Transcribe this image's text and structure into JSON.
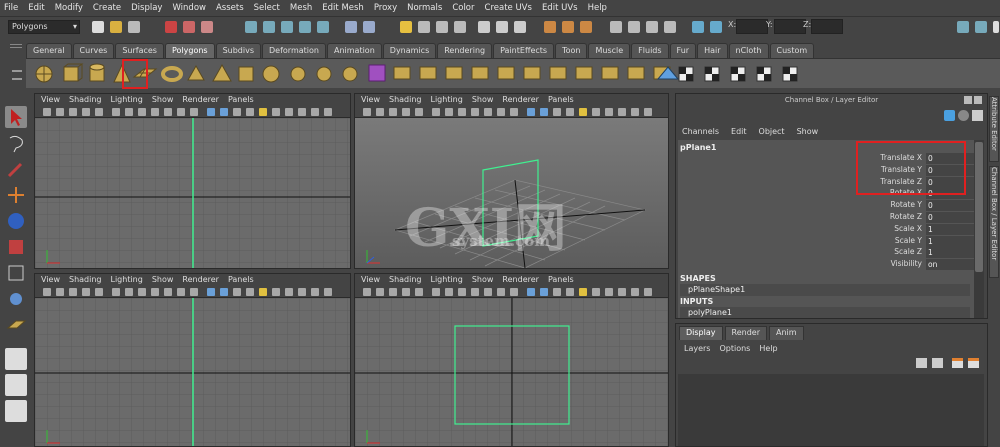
{
  "menubar": [
    "File",
    "Edit",
    "Modify",
    "Create",
    "Display",
    "Window",
    "Assets",
    "Select",
    "Mesh",
    "Edit Mesh",
    "Proxy",
    "Normals",
    "Color",
    "Create UVs",
    "Edit UVs",
    "Help"
  ],
  "status": {
    "mode": "Polygons",
    "x_label": "X:",
    "y_label": "Y:",
    "z_label": "Z:"
  },
  "shelf_tabs": [
    {
      "label": "General",
      "active": false
    },
    {
      "label": "Curves",
      "active": false
    },
    {
      "label": "Surfaces",
      "active": false
    },
    {
      "label": "Polygons",
      "active": true
    },
    {
      "label": "Subdivs",
      "active": false
    },
    {
      "label": "Deformation",
      "active": false
    },
    {
      "label": "Animation",
      "active": false
    },
    {
      "label": "Dynamics",
      "active": false
    },
    {
      "label": "Rendering",
      "active": false
    },
    {
      "label": "PaintEffects",
      "active": false
    },
    {
      "label": "Toon",
      "active": false
    },
    {
      "label": "Muscle",
      "active": false
    },
    {
      "label": "Fluids",
      "active": false
    },
    {
      "label": "Fur",
      "active": false
    },
    {
      "label": "Hair",
      "active": false
    },
    {
      "label": "nCloth",
      "active": false
    },
    {
      "label": "Custom",
      "active": false
    }
  ],
  "viewport_menu": [
    "View",
    "Shading",
    "Lighting",
    "Show",
    "Renderer",
    "Panels"
  ],
  "channel_box": {
    "title": "Channel Box / Layer Editor",
    "menu": [
      "Channels",
      "Edit",
      "Object",
      "Show"
    ],
    "object_name": "pPlane1",
    "attributes": [
      {
        "name": "Translate X",
        "value": "0"
      },
      {
        "name": "Translate Y",
        "value": "0"
      },
      {
        "name": "Translate Z",
        "value": "0"
      },
      {
        "name": "Rotate X",
        "value": "0"
      },
      {
        "name": "Rotate Y",
        "value": "0"
      },
      {
        "name": "Rotate Z",
        "value": "0"
      },
      {
        "name": "Scale X",
        "value": "1"
      },
      {
        "name": "Scale Y",
        "value": "1"
      },
      {
        "name": "Scale Z",
        "value": "1"
      },
      {
        "name": "Visibility",
        "value": "on"
      }
    ],
    "shapes_label": "SHAPES",
    "shape_name": "pPlaneShape1",
    "inputs_label": "INPUTS",
    "input_name": "polyPlane1"
  },
  "side_tabs": {
    "attribute_editor": "Attribute Editor",
    "channel_box": "Channel Box / Layer Editor"
  },
  "layer_editor": {
    "tabs": [
      {
        "label": "Display",
        "active": true
      },
      {
        "label": "Render",
        "active": false
      },
      {
        "label": "Anim",
        "active": false
      }
    ],
    "menu": [
      "Layers",
      "Options",
      "Help"
    ]
  },
  "watermark": {
    "main": "GXI网",
    "sub": "system.com"
  },
  "colors": {
    "highlight": "#e02020",
    "selection_green": "#5ff0a0",
    "viewport_bg": "#6b6b6b"
  }
}
